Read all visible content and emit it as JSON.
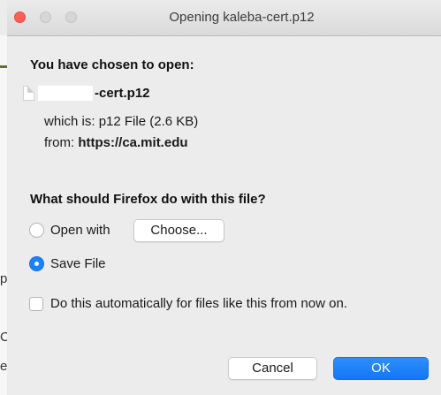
{
  "window": {
    "title": "Opening kaleba-cert.p12"
  },
  "background": {
    "chars": [
      "p",
      "C",
      "e"
    ]
  },
  "dialog": {
    "chosen_heading": "You have chosen to open:",
    "file_name": "-cert.p12",
    "which_is_label": "which is:",
    "which_is_value": "p12 File (2.6 KB)",
    "from_label": "from:",
    "from_value": "https://ca.mit.edu",
    "action_heading": "What should Firefox do with this file?",
    "open_with_label": "Open with",
    "choose_button": "Choose...",
    "save_file_label": "Save File",
    "selected_option": "Save File",
    "auto_label": "Do this automatically for files like this from now on.",
    "auto_checked": false,
    "cancel_button": "Cancel",
    "ok_button": "OK"
  },
  "colors": {
    "accent": "#1a82fb",
    "close": "#fc5f57"
  }
}
